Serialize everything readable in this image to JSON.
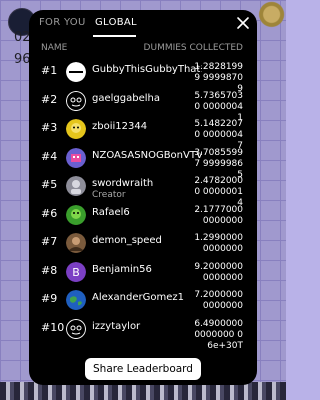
{
  "background": {
    "value_1": "02",
    "value_2": "96"
  },
  "tabs": {
    "for_you": "FOR YOU",
    "global": "GLOBAL"
  },
  "headers": {
    "name": "NAME",
    "dummies": "DUMMIES COLLECTED"
  },
  "rows": [
    {
      "rank": "#1",
      "name": "GubbyThisGubbyThat123",
      "sub": "",
      "score": "1.28281999 99998709",
      "avatar": "white-circle-avatar"
    },
    {
      "rank": "#2",
      "name": "gaelggabelha",
      "sub": "",
      "score": "5.73657030 00000041",
      "avatar": "mascot-avatar"
    },
    {
      "rank": "#3",
      "name": "zboii12344",
      "sub": "",
      "score": "5.14822070 00000047",
      "avatar": "yellow-character-avatar"
    },
    {
      "rank": "#4",
      "name": "NZOASASNOGBonVTV",
      "sub": "",
      "score": "3.70855997 99999865",
      "avatar": "pixel-avatar"
    },
    {
      "rank": "#5",
      "name": "swordwraith",
      "sub": "Creator",
      "score": "2.47820000 00000014",
      "avatar": "gray-character-avatar"
    },
    {
      "rank": "#6",
      "name": "Rafael6",
      "sub": "",
      "score": "2.1777000 0000000",
      "avatar": "green-character-avatar"
    },
    {
      "rank": "#7",
      "name": "demon_speed",
      "sub": "",
      "score": "1.2990000 0000000",
      "avatar": "photo-avatar"
    },
    {
      "rank": "#8",
      "name": "Benjamin56",
      "sub": "",
      "score": "9.2000000 0000000",
      "avatar": "letter-b-avatar",
      "initial": "B"
    },
    {
      "rank": "#9",
      "name": "AlexanderGomez1",
      "sub": "",
      "score": "7.2000000 0000000",
      "avatar": "globe-avatar"
    },
    {
      "rank": "#10",
      "name": "izzytaylor",
      "sub": "",
      "score": "6.4900000 0000000 06e+30T",
      "avatar": "mascot-avatar"
    }
  ],
  "share_label": "Share Leaderboard",
  "colors": {
    "modal": "#000000",
    "accent_b": "#7b3fc4",
    "muted": "#9a9a9a"
  }
}
